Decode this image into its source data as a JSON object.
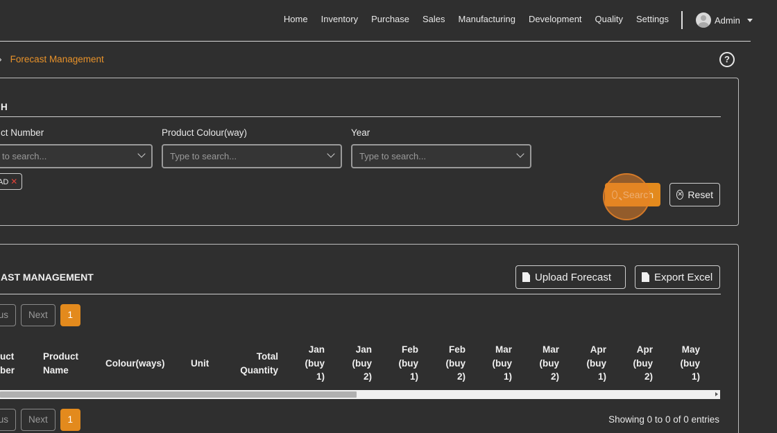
{
  "nav": {
    "items": [
      "Home",
      "Inventory",
      "Purchase",
      "Sales",
      "Manufacturing",
      "Development",
      "Quality",
      "Settings"
    ],
    "user": "Admin"
  },
  "breadcrumb": {
    "current": "Forecast Management"
  },
  "search": {
    "title": "H",
    "fields": [
      {
        "label": "ct Number",
        "placeholder": "to search..."
      },
      {
        "label": "Product Colour(way)",
        "placeholder": "Type to search..."
      },
      {
        "label": "Year",
        "placeholder": "Type to search..."
      }
    ],
    "chip": "AD",
    "search_label": "Search",
    "reset_label": "Reset"
  },
  "table": {
    "title": "AST MANAGEMENT",
    "upload_label": "Upload Forecast",
    "export_label": "Export Excel",
    "pager": {
      "prev": "us",
      "next": "Next",
      "page": "1"
    },
    "columns": [
      [
        "uct",
        "ber"
      ],
      [
        "Product",
        "Name"
      ],
      [
        "Colour(ways)"
      ],
      [
        "Unit"
      ],
      [
        "Total",
        "Quantity"
      ],
      [
        "Jan",
        "(buy",
        "1)"
      ],
      [
        "Jan",
        "(buy",
        "2)"
      ],
      [
        "Feb",
        "(buy",
        "1)"
      ],
      [
        "Feb",
        "(buy",
        "2)"
      ],
      [
        "Mar",
        "(buy",
        "1)"
      ],
      [
        "Mar",
        "(buy",
        "2)"
      ],
      [
        "Apr",
        "(buy",
        "1)"
      ],
      [
        "Apr",
        "(buy",
        "2)"
      ],
      [
        "May",
        "(buy",
        "1)"
      ]
    ],
    "showing": "Showing 0 to 0 of 0 entries"
  },
  "colors": {
    "accent": "#e38a1d",
    "background": "#2f2f2f"
  }
}
